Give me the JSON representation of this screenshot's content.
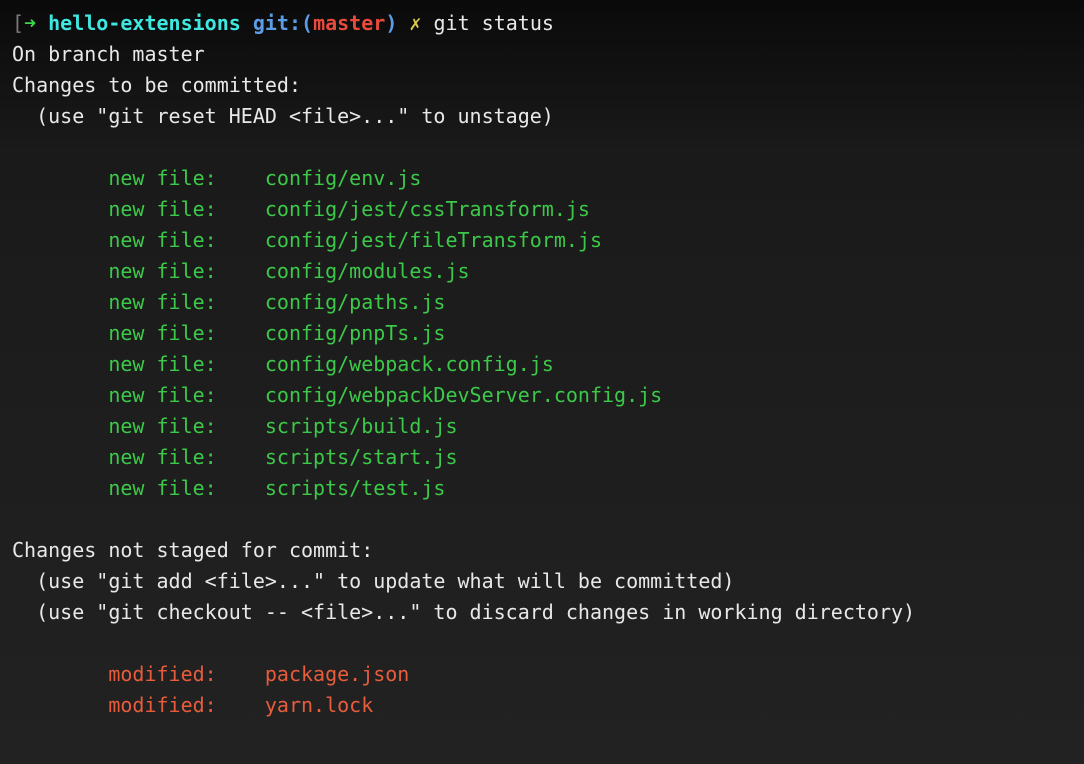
{
  "prompt": {
    "bracket_open": "[",
    "arrow": "➜",
    "dirname": "hello-extensions",
    "gitlabel": "git:",
    "paren_open": "(",
    "branch": "master",
    "paren_close": ")",
    "separator": "✗",
    "command": "git status"
  },
  "output": {
    "branch_line": "On branch master",
    "staged_header": "Changes to be committed:",
    "staged_hint": "(use \"git reset HEAD <file>...\" to unstage)",
    "staged_files": [
      {
        "status": "new file:",
        "path": "config/env.js"
      },
      {
        "status": "new file:",
        "path": "config/jest/cssTransform.js"
      },
      {
        "status": "new file:",
        "path": "config/jest/fileTransform.js"
      },
      {
        "status": "new file:",
        "path": "config/modules.js"
      },
      {
        "status": "new file:",
        "path": "config/paths.js"
      },
      {
        "status": "new file:",
        "path": "config/pnpTs.js"
      },
      {
        "status": "new file:",
        "path": "config/webpack.config.js"
      },
      {
        "status": "new file:",
        "path": "config/webpackDevServer.config.js"
      },
      {
        "status": "new file:",
        "path": "scripts/build.js"
      },
      {
        "status": "new file:",
        "path": "scripts/start.js"
      },
      {
        "status": "new file:",
        "path": "scripts/test.js"
      }
    ],
    "unstaged_header": "Changes not staged for commit:",
    "unstaged_hint1": "(use \"git add <file>...\" to update what will be committed)",
    "unstaged_hint2": "(use \"git checkout -- <file>...\" to discard changes in working directory)",
    "unstaged_files": [
      {
        "status": "modified:",
        "path": "package.json"
      },
      {
        "status": "modified:",
        "path": "yarn.lock"
      }
    ]
  }
}
